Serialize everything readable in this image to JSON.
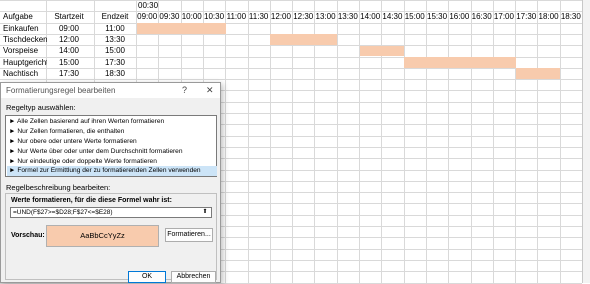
{
  "sheet": {
    "top_cell": "00:30",
    "header": {
      "task": "Aufgabe",
      "start": "Startzeit",
      "end": "Endzeit"
    },
    "time_headers": [
      "09:00",
      "09:30",
      "10:00",
      "10:30",
      "11:00",
      "11:30",
      "12:00",
      "12:30",
      "13:00",
      "13:30",
      "14:00",
      "14:30",
      "15:00",
      "15:30",
      "16:00",
      "16:30",
      "17:00",
      "17:30",
      "18:00",
      "18:30"
    ],
    "rows": [
      {
        "task": "Einkaufen",
        "start": "09:00",
        "end": "11:00"
      },
      {
        "task": "Tischdecken",
        "start": "12:00",
        "end": "13:30"
      },
      {
        "task": "Vorspeise",
        "start": "14:00",
        "end": "15:00"
      },
      {
        "task": "Hauptgericht",
        "start": "15:00",
        "end": "17:30"
      },
      {
        "task": "Nachtisch",
        "start": "17:30",
        "end": "18:30"
      }
    ],
    "fill_color": "#f8cbad"
  },
  "dialog": {
    "title": "Formatierungsregel bearbeiten",
    "help": "?",
    "close": "✕",
    "rule_type_label": "Regeltyp auswählen:",
    "rule_types": [
      "► Alle Zellen basierend auf ihren Werten formatieren",
      "► Nur Zellen formatieren, die enthalten",
      "► Nur obere oder untere Werte formatieren",
      "► Nur Werte über oder unter dem Durchschnitt formatieren",
      "► Nur eindeutige oder doppelte Werte formatieren",
      "► Formel zur Ermittlung der zu formatierenden Zellen verwenden"
    ],
    "selected_index": 5,
    "rule_desc_label": "Regelbeschreibung bearbeiten:",
    "formula_label": "Werte formatieren, für die diese Formel wahr ist:",
    "formula": "=UND(F$27>=$D28;F$27<=$E28)",
    "collapse_icon": "⬆",
    "preview_label": "Vorschau:",
    "preview_text": "AaBbCcYyZz",
    "format_button": "Formatieren...",
    "ok_button": "OK",
    "cancel_button": "Abbrechen"
  }
}
